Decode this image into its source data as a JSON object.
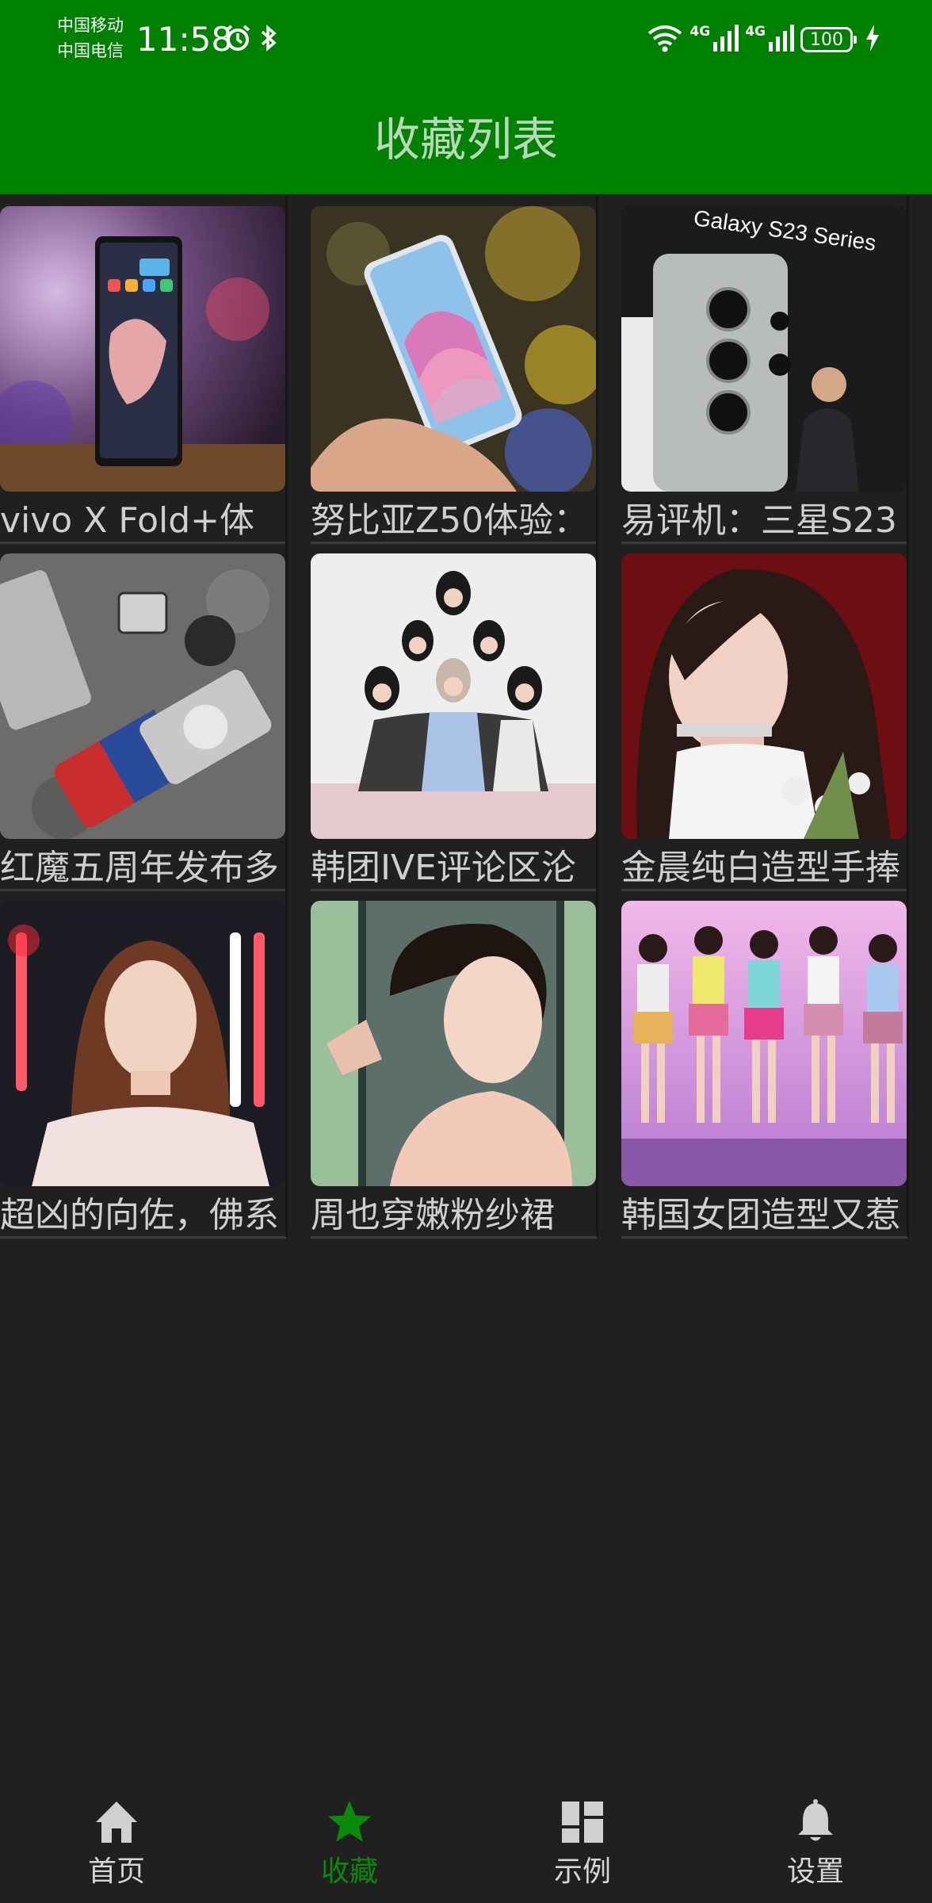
{
  "status_bar": {
    "carrier_1": "中国移动",
    "carrier_2": "中国电信",
    "time": "11:58",
    "net_1": "4G",
    "net_2": "4G",
    "battery": "100",
    "icons": [
      "alarm-icon",
      "bluetooth-icon",
      "wifi-icon",
      "signal-icon",
      "charging-icon"
    ]
  },
  "header": {
    "title": "收藏列表",
    "background_color": "#008000"
  },
  "favorites": [
    {
      "title": "vivo X Fold+体",
      "thumb_icon": "foldable-phone-photo"
    },
    {
      "title": "努比亚Z50体验：",
      "thumb_icon": "phone-in-hand-photo"
    },
    {
      "title": "易评机：三星S23",
      "thumb_icon": "galaxy-s23-photo"
    },
    {
      "title": "红魔五周年发布多",
      "thumb_icon": "gaming-accessories-photo"
    },
    {
      "title": "韩团IVE评论区沦",
      "thumb_icon": "group-photo"
    },
    {
      "title": "金晨纯白造型手捧",
      "thumb_icon": "portrait-photo"
    },
    {
      "title": "超凶的向佐，佛系",
      "thumb_icon": "portrait-photo"
    },
    {
      "title": "周也穿嫩粉纱裙",
      "thumb_icon": "portrait-photo"
    },
    {
      "title": "韩国女团造型又惹",
      "thumb_icon": "dance-group-photo"
    }
  ],
  "thumb_overlay_text": {
    "galaxy": "Galaxy S23 Series"
  },
  "bottom_nav": [
    {
      "label": "首页",
      "icon": "home-icon",
      "active": false
    },
    {
      "label": "收藏",
      "icon": "star-icon",
      "active": true
    },
    {
      "label": "示例",
      "icon": "grid-icon",
      "active": false
    },
    {
      "label": "设置",
      "icon": "bell-icon",
      "active": false
    }
  ],
  "colors": {
    "accent": "#008000",
    "active_nav": "#0a8a0a",
    "background": "#202020"
  }
}
